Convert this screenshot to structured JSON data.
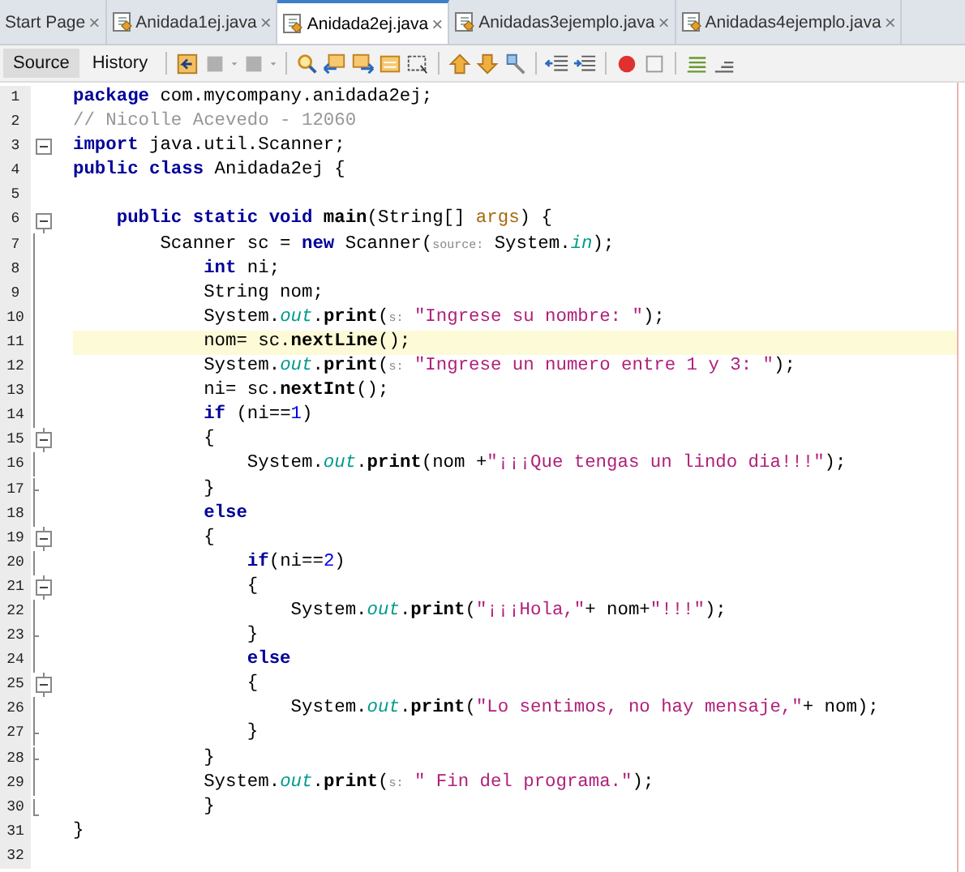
{
  "tabs": [
    {
      "label": "Start Page",
      "close": "×",
      "selected": false,
      "file": false
    },
    {
      "label": "Anidada1ej.java",
      "close": "×",
      "selected": false,
      "file": true
    },
    {
      "label": "Anidada2ej.java",
      "close": "×",
      "selected": true,
      "file": true
    },
    {
      "label": "Anidadas3ejemplo.java",
      "close": "×",
      "selected": false,
      "file": true
    },
    {
      "label": "Anidadas4ejemplo.java",
      "close": "×",
      "selected": false,
      "file": true
    }
  ],
  "view_tabs": [
    {
      "label": "Source",
      "selected": true
    },
    {
      "label": "History",
      "selected": false
    }
  ],
  "lines": [
    {
      "number": "1",
      "current": false,
      "tokens": [
        {
          "kind": "kw",
          "text": "package"
        },
        {
          "kind": "pl",
          "text": " com.mycompany.anidada2ej;"
        }
      ]
    },
    {
      "number": "2",
      "current": false,
      "tokens": [
        {
          "kind": "cm",
          "text": "// Nicolle Acevedo - 12060"
        }
      ]
    },
    {
      "number": "3",
      "fold": {
        "kind": "box"
      },
      "current": false,
      "tokens": [
        {
          "kind": "kw",
          "text": "import"
        },
        {
          "kind": "pl",
          "text": " java.util.Scanner;"
        }
      ]
    },
    {
      "number": "4",
      "current": false,
      "tokens": [
        {
          "kind": "kw",
          "text": "public class"
        },
        {
          "kind": "pl",
          "text": " Anidada2ej {"
        }
      ]
    },
    {
      "number": "5"
    },
    {
      "number": "6",
      "fold": {
        "kind": "start"
      },
      "current": false,
      "tokens": [
        {
          "kind": "kw",
          "text": "    public static void"
        },
        {
          "kind": "mth",
          "text": " main"
        },
        {
          "kind": "pl",
          "text": "(String[] "
        },
        {
          "kind": "arg",
          "text": "args"
        },
        {
          "kind": "pl",
          "text": ") {"
        }
      ]
    },
    {
      "number": "7",
      "fold": {
        "kind": "mid"
      },
      "current": false,
      "tokens": [
        {
          "kind": "pl",
          "text": "        Scanner sc = "
        },
        {
          "kind": "kw",
          "text": "new"
        },
        {
          "kind": "pl",
          "text": " Scanner("
        },
        {
          "kind": "hint",
          "text": "source:"
        },
        {
          "kind": "pl",
          "text": " System."
        },
        {
          "kind": "fld",
          "text": "in"
        },
        {
          "kind": "pl",
          "text": ");"
        }
      ]
    },
    {
      "number": "8",
      "fold": {
        "kind": "mid"
      },
      "current": false,
      "tokens": [
        {
          "kind": "kw",
          "text": "            int"
        },
        {
          "kind": "pl",
          "text": " ni;"
        }
      ]
    },
    {
      "number": "9",
      "fold": {
        "kind": "mid"
      },
      "current": false,
      "tokens": [
        {
          "kind": "pl",
          "text": "            String nom;"
        }
      ]
    },
    {
      "number": "10",
      "fold": {
        "kind": "mid"
      },
      "current": false,
      "tokens": [
        {
          "kind": "pl",
          "text": "            System."
        },
        {
          "kind": "fld",
          "text": "out"
        },
        {
          "kind": "pl",
          "text": "."
        },
        {
          "kind": "mth",
          "text": "print"
        },
        {
          "kind": "pl",
          "text": "("
        },
        {
          "kind": "hint",
          "text": "s:"
        },
        {
          "kind": "str",
          "text": " \"Ingrese su nombre: \""
        },
        {
          "kind": "pl",
          "text": ");"
        }
      ]
    },
    {
      "number": "11",
      "fold": {
        "kind": "mid"
      },
      "current": true,
      "tokens": [
        {
          "kind": "pl",
          "text": "            nom= sc."
        },
        {
          "kind": "mth",
          "text": "nextLine"
        },
        {
          "kind": "pl",
          "text": "();"
        }
      ]
    },
    {
      "number": "12",
      "fold": {
        "kind": "mid"
      },
      "current": false,
      "tokens": [
        {
          "kind": "pl",
          "text": "            System."
        },
        {
          "kind": "fld",
          "text": "out"
        },
        {
          "kind": "pl",
          "text": "."
        },
        {
          "kind": "mth",
          "text": "print"
        },
        {
          "kind": "pl",
          "text": "("
        },
        {
          "kind": "hint",
          "text": "s:"
        },
        {
          "kind": "str",
          "text": " \"Ingrese un numero entre 1 y 3: \""
        },
        {
          "kind": "pl",
          "text": ");"
        }
      ]
    },
    {
      "number": "13",
      "fold": {
        "kind": "mid"
      },
      "current": false,
      "tokens": [
        {
          "kind": "pl",
          "text": "            ni= sc."
        },
        {
          "kind": "mth",
          "text": "nextInt"
        },
        {
          "kind": "pl",
          "text": "();"
        }
      ]
    },
    {
      "number": "14",
      "fold": {
        "kind": "mid"
      },
      "current": false,
      "tokens": [
        {
          "kind": "kw",
          "text": "            if"
        },
        {
          "kind": "pl",
          "text": " (ni=="
        },
        {
          "kind": "num",
          "text": "1"
        },
        {
          "kind": "pl",
          "text": ")"
        }
      ]
    },
    {
      "number": "15",
      "fold": {
        "kind": "open"
      },
      "current": false,
      "tokens": [
        {
          "kind": "pl",
          "text": "            {"
        }
      ]
    },
    {
      "number": "16",
      "fold": {
        "kind": "mid"
      },
      "current": false,
      "tokens": [
        {
          "kind": "pl",
          "text": "                System."
        },
        {
          "kind": "fld",
          "text": "out"
        },
        {
          "kind": "pl",
          "text": "."
        },
        {
          "kind": "mth",
          "text": "print"
        },
        {
          "kind": "pl",
          "text": "(nom +"
        },
        {
          "kind": "str",
          "text": "\"¡¡¡Que tengas un lindo dia!!!\""
        },
        {
          "kind": "pl",
          "text": ");"
        }
      ]
    },
    {
      "number": "17",
      "fold": {
        "kind": "tick"
      },
      "current": false,
      "tokens": [
        {
          "kind": "pl",
          "text": "            }"
        }
      ]
    },
    {
      "number": "18",
      "fold": {
        "kind": "mid"
      },
      "current": false,
      "tokens": [
        {
          "kind": "kw",
          "text": "            else"
        }
      ]
    },
    {
      "number": "19",
      "fold": {
        "kind": "open"
      },
      "current": false,
      "tokens": [
        {
          "kind": "pl",
          "text": "            {"
        }
      ]
    },
    {
      "number": "20",
      "fold": {
        "kind": "mid"
      },
      "current": false,
      "tokens": [
        {
          "kind": "kw",
          "text": "                if"
        },
        {
          "kind": "pl",
          "text": "(ni=="
        },
        {
          "kind": "num",
          "text": "2"
        },
        {
          "kind": "pl",
          "text": ")"
        }
      ]
    },
    {
      "number": "21",
      "fold": {
        "kind": "open"
      },
      "current": false,
      "tokens": [
        {
          "kind": "pl",
          "text": "                {"
        }
      ]
    },
    {
      "number": "22",
      "fold": {
        "kind": "mid"
      },
      "current": false,
      "tokens": [
        {
          "kind": "pl",
          "text": "                    System."
        },
        {
          "kind": "fld",
          "text": "out"
        },
        {
          "kind": "pl",
          "text": "."
        },
        {
          "kind": "mth",
          "text": "print"
        },
        {
          "kind": "pl",
          "text": "("
        },
        {
          "kind": "str",
          "text": "\"¡¡¡Hola,\""
        },
        {
          "kind": "pl",
          "text": "+ nom+"
        },
        {
          "kind": "str",
          "text": "\"!!!\""
        },
        {
          "kind": "pl",
          "text": ");"
        }
      ]
    },
    {
      "number": "23",
      "fold": {
        "kind": "tick"
      },
      "current": false,
      "tokens": [
        {
          "kind": "pl",
          "text": "                }"
        }
      ]
    },
    {
      "number": "24",
      "fold": {
        "kind": "mid"
      },
      "current": false,
      "tokens": [
        {
          "kind": "kw",
          "text": "                else"
        }
      ]
    },
    {
      "number": "25",
      "fold": {
        "kind": "open"
      },
      "current": false,
      "tokens": [
        {
          "kind": "pl",
          "text": "                {"
        }
      ]
    },
    {
      "number": "26",
      "fold": {
        "kind": "mid"
      },
      "current": false,
      "tokens": [
        {
          "kind": "pl",
          "text": "                    System."
        },
        {
          "kind": "fld",
          "text": "out"
        },
        {
          "kind": "pl",
          "text": "."
        },
        {
          "kind": "mth",
          "text": "print"
        },
        {
          "kind": "pl",
          "text": "("
        },
        {
          "kind": "str",
          "text": "\"Lo sentimos, no hay mensaje,\""
        },
        {
          "kind": "pl",
          "text": "+ nom);"
        }
      ]
    },
    {
      "number": "27",
      "fold": {
        "kind": "tick"
      },
      "current": false,
      "tokens": [
        {
          "kind": "pl",
          "text": "                }"
        }
      ]
    },
    {
      "number": "28",
      "fold": {
        "kind": "tick"
      },
      "current": false,
      "tokens": [
        {
          "kind": "pl",
          "text": "            }"
        }
      ]
    },
    {
      "number": "29",
      "fold": {
        "kind": "mid"
      },
      "current": false,
      "tokens": [
        {
          "kind": "pl",
          "text": "            System."
        },
        {
          "kind": "fld",
          "text": "out"
        },
        {
          "kind": "pl",
          "text": "."
        },
        {
          "kind": "mth",
          "text": "print"
        },
        {
          "kind": "pl",
          "text": "("
        },
        {
          "kind": "hint",
          "text": "s:"
        },
        {
          "kind": "str",
          "text": " \" Fin del programa.\""
        },
        {
          "kind": "pl",
          "text": ");"
        }
      ]
    },
    {
      "number": "30",
      "fold": {
        "kind": "last"
      },
      "current": false,
      "tokens": [
        {
          "kind": "pl",
          "text": "            }"
        }
      ]
    },
    {
      "number": "31",
      "current": false,
      "tokens": [
        {
          "kind": "pl",
          "text": "}"
        }
      ]
    },
    {
      "number": "32"
    }
  ]
}
